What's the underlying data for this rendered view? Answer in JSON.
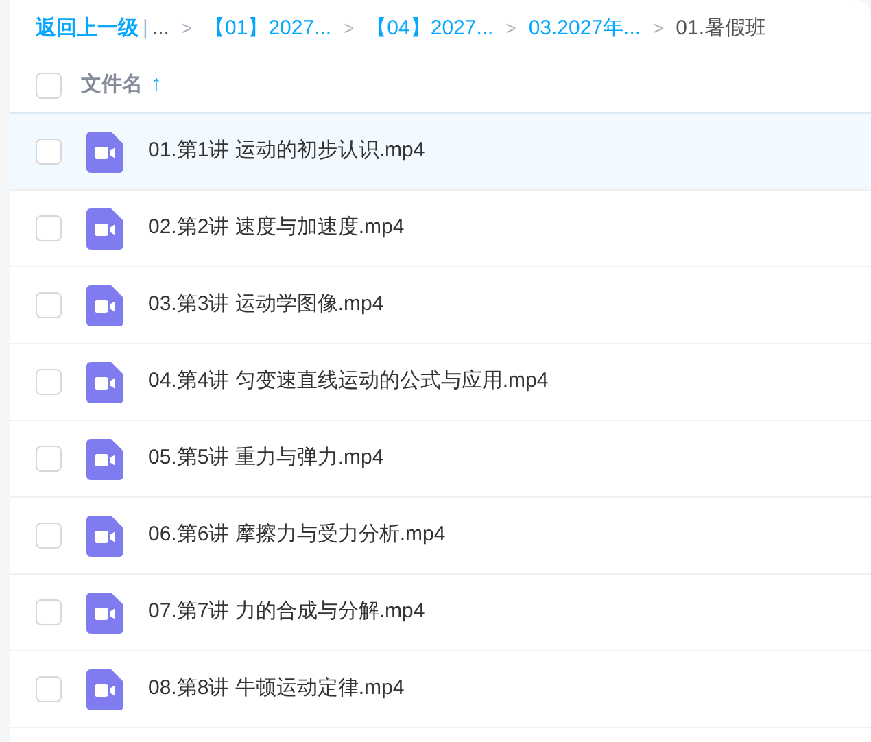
{
  "breadcrumb": {
    "back": "返回上一级",
    "divider": "|",
    "separator": ">",
    "items": [
      {
        "label": "...",
        "kind": "ellipsis"
      },
      {
        "label": "【01】2027...",
        "kind": "link"
      },
      {
        "label": "【04】2027...",
        "kind": "link"
      },
      {
        "label": "03.2027年...",
        "kind": "link"
      },
      {
        "label": "01.暑假班",
        "kind": "current"
      }
    ]
  },
  "header": {
    "checked": false,
    "column": "文件名",
    "sort_arrow": "↑"
  },
  "files": [
    {
      "name": "01.第1讲 运动的初步认识.mp4",
      "checked": false,
      "selected": true
    },
    {
      "name": "02.第2讲 速度与加速度.mp4",
      "checked": false,
      "selected": false
    },
    {
      "name": "03.第3讲 运动学图像.mp4",
      "checked": false,
      "selected": false
    },
    {
      "name": "04.第4讲 匀变速直线运动的公式与应用.mp4",
      "checked": false,
      "selected": false
    },
    {
      "name": "05.第5讲 重力与弹力.mp4",
      "checked": false,
      "selected": false
    },
    {
      "name": "06.第6讲 摩擦力与受力分析.mp4",
      "checked": false,
      "selected": false
    },
    {
      "name": "07.第7讲 力的合成与分解.mp4",
      "checked": false,
      "selected": false
    },
    {
      "name": "08.第8讲 牛顿运动定律.mp4",
      "checked": false,
      "selected": false
    }
  ]
}
